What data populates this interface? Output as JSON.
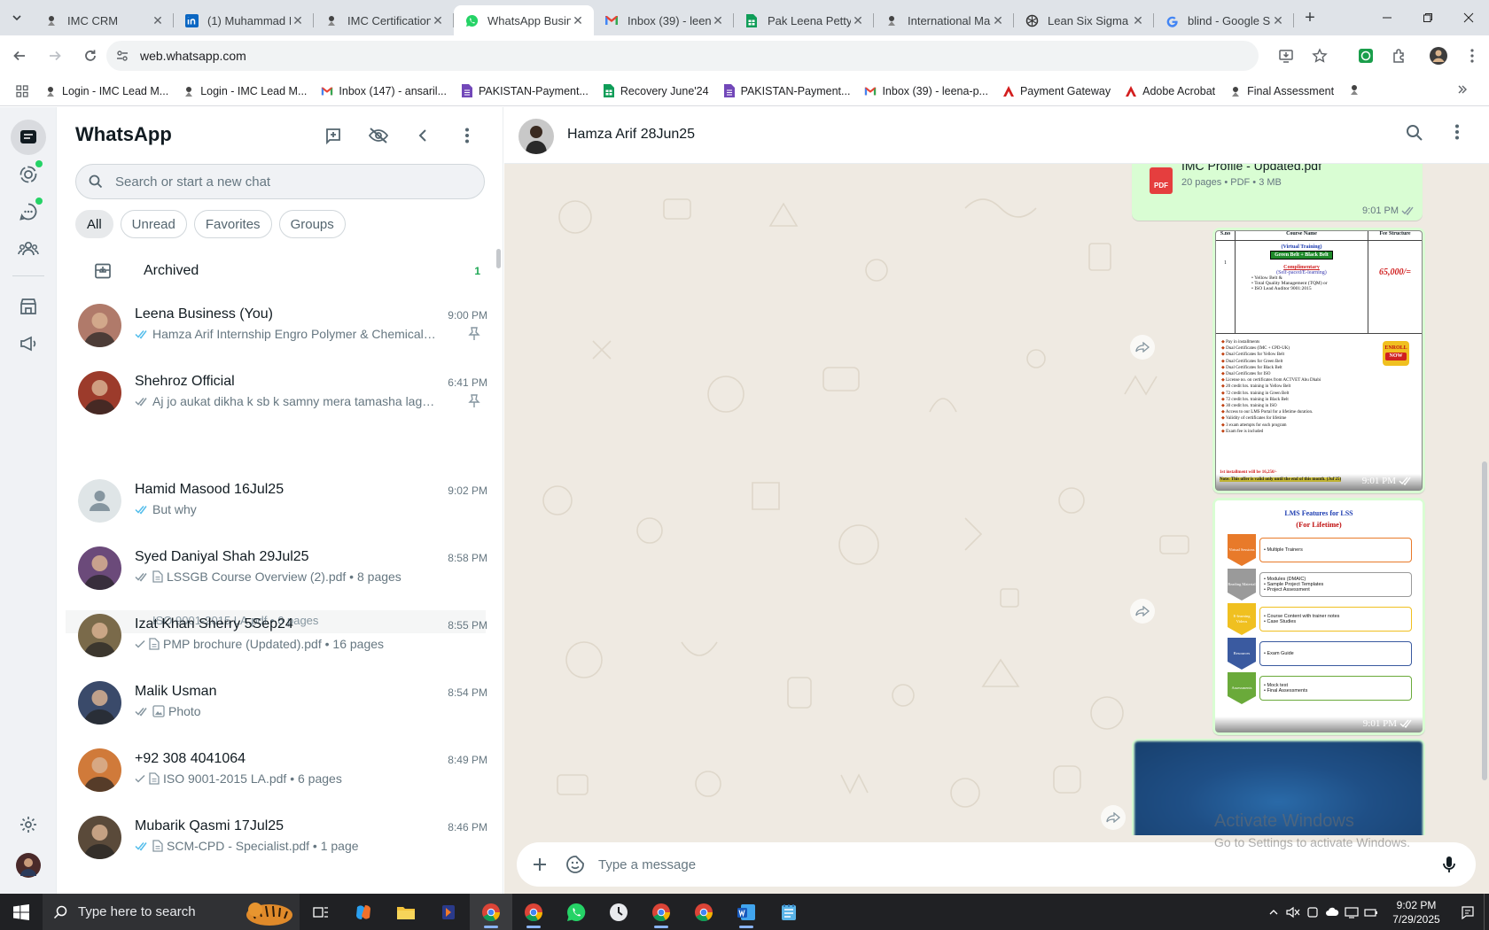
{
  "browser": {
    "tabs": [
      {
        "title": "IMC CRM",
        "favicon": "imc-icon",
        "active": false
      },
      {
        "title": "(1) Muhammad I",
        "favicon": "linkedin-icon",
        "active": false
      },
      {
        "title": "IMC Certification",
        "favicon": "imc-icon",
        "active": false
      },
      {
        "title": "WhatsApp Busin",
        "favicon": "whatsapp-icon",
        "active": true
      },
      {
        "title": "Inbox (39) - leen",
        "favicon": "gmail-icon",
        "active": false
      },
      {
        "title": "Pak Leena Petty",
        "favicon": "sheets-icon",
        "active": false
      },
      {
        "title": "International Ma",
        "favicon": "imc-icon",
        "active": false
      },
      {
        "title": "Lean Six Sigma C",
        "favicon": "chatgpt-icon",
        "active": false
      },
      {
        "title": "blind - Google S",
        "favicon": "google-icon",
        "active": false
      }
    ],
    "url": "web.whatsapp.com",
    "bookmarks": [
      {
        "label": "Login - IMC Lead M...",
        "icon": "imc-icon"
      },
      {
        "label": "Login - IMC Lead M...",
        "icon": "imc-icon"
      },
      {
        "label": "Inbox (147) - ansaril...",
        "icon": "gmail-icon"
      },
      {
        "label": "PAKISTAN-Payment...",
        "icon": "forms-icon"
      },
      {
        "label": "Recovery June'24",
        "icon": "sheets-icon"
      },
      {
        "label": "PAKISTAN-Payment...",
        "icon": "forms-icon"
      },
      {
        "label": "Inbox (39) - leena-p...",
        "icon": "gmail-icon"
      },
      {
        "label": "Payment Gateway",
        "icon": "acrobat-icon"
      },
      {
        "label": "Adobe Acrobat",
        "icon": "acrobat-icon"
      },
      {
        "label": "Final Assessment",
        "icon": "imc-icon"
      }
    ]
  },
  "sidebar": {
    "title": "WhatsApp",
    "search_placeholder": "Search or start a new chat",
    "filters": [
      "All",
      "Unread",
      "Favorites",
      "Groups"
    ],
    "archived_label": "Archived",
    "archived_count": "1",
    "ghost_preview": "ISO 9001-2015 LA.pdf • 6 pages",
    "chats": [
      {
        "name": "Leena Business (You)",
        "time": "9:00 PM",
        "preview": "Hamza Arif Internship Engro Polymer & Chemical Li...",
        "tick": "double-blue",
        "pinned": true,
        "avatar": "#b07a6a"
      },
      {
        "name": "Shehroz Official",
        "time": "6:41 PM",
        "preview": "Aj jo aukat dikha k sb k samny mera tamasha lagay...",
        "tick": "double-grey",
        "pinned": true,
        "avatar": "#9c3b2b"
      },
      {
        "name": "Hamid Masood 16Jul25",
        "time": "9:02 PM",
        "preview": "But why",
        "tick": "double-blue",
        "pinned": false,
        "avatar": "default"
      },
      {
        "name": "Syed Daniyal Shah 29Jul25",
        "time": "8:58 PM",
        "preview": "LSSGB Course Overview (2).pdf • 8 pages",
        "tick": "double-grey",
        "doc": true,
        "pinned": false,
        "avatar": "#6b4a7a"
      },
      {
        "name": "Izat Khan Sherry 5Sep24",
        "time": "8:55 PM",
        "preview": "PMP brochure (Updated).pdf • 16 pages",
        "tick": "single",
        "doc": true,
        "pinned": false,
        "avatar": "#7a6a4a"
      },
      {
        "name": "Malik Usman",
        "time": "8:54 PM",
        "preview": "Photo",
        "tick": "double-grey",
        "photo": true,
        "pinned": false,
        "avatar": "#3a4a6a"
      },
      {
        "name": "+92 308 4041064",
        "time": "8:49 PM",
        "preview": "ISO 9001-2015 LA.pdf • 6 pages",
        "tick": "single",
        "doc": true,
        "pinned": false,
        "avatar": "#d07a3a"
      },
      {
        "name": "Mubarik Qasmi 17Jul25",
        "time": "8:46 PM",
        "preview": "SCM-CPD - Specialist.pdf • 1 page",
        "tick": "double-blue",
        "doc": true,
        "pinned": false,
        "avatar": "#5a4a3a"
      }
    ]
  },
  "conversation": {
    "contact_name": "Hamza Arif 28Jun25",
    "messages": [
      {
        "type": "document",
        "title": "IMC Profile - Updated.pdf",
        "meta": "20 pages • PDF • 3 MB",
        "badge": "PDF",
        "time": "9:01 PM"
      },
      {
        "type": "image",
        "time": "9:01 PM",
        "table_headers": [
          "S.no",
          "Course Name",
          "Fee Structure"
        ],
        "sno": "1",
        "mode": "(Virtual Training)",
        "program": "Green Belt + Black Belt",
        "fee": "65,000/=",
        "complimentary": "Complimentary",
        "complimentary_sub": "(Self-paced/E-learning)",
        "complimentary_items": [
          "Yellow Belt &",
          "Total Quality Management (TQM) or",
          "ISO Lead Auditor 9001:2015"
        ],
        "benefits": [
          "Pay in installments",
          "Dual Certificates (IMC + CPD-UK)",
          "Dual Certificates for Yellow Belt",
          "Dual Certificates for Green Belt",
          "Dual Certificates for Black Belt",
          "Dual Certificates for ISO",
          "License no. on certificates from ACTVET Abu Dhabi",
          "20 credit hrs. training in Yellow Belt",
          "72 credit hrs. training in Green Belt",
          "72 credit hrs. training in Black Belt",
          "30 credit hrs. training in ISO",
          "Access to our LMS Portal for a lifetime duration.",
          "Validity of certificates for lifetime",
          "3 exam attempts for each program",
          "Exam fee is included"
        ],
        "enroll": [
          "ENROLL",
          "NOW"
        ],
        "installment_note": "1st installment will be 16,250/-",
        "note": "Note: This offer is valid only until the end of this month. (Jul'25)"
      },
      {
        "type": "image",
        "time": "9:01 PM",
        "lms_title": "LMS Features for LSS",
        "lms_subtitle": "(For Lifetime)",
        "rows": [
          {
            "tag": "Virtual Sessions",
            "color": "#e87a2a",
            "items": [
              "Multiple Trainers"
            ]
          },
          {
            "tag": "Reading Material",
            "color": "#9a9a9a",
            "items": [
              "Modules (DMAIC)",
              "Sample Project Templates",
              "Project Assessment"
            ]
          },
          {
            "tag": "E-learning Videos",
            "color": "#f0c020",
            "items": [
              "Course Content with trainer notes",
              "Case Studies"
            ]
          },
          {
            "tag": "Resources",
            "color": "#3a5aa0",
            "items": [
              "Exam Guide"
            ]
          },
          {
            "tag": "Assessments",
            "color": "#6aaa3a",
            "items": [
              "Mock test",
              "Final Assessments"
            ]
          }
        ]
      },
      {
        "type": "image-blurred"
      }
    ],
    "composer_placeholder": "Type a message",
    "watermark_line1": "Activate Windows",
    "watermark_line2": "Go to Settings to activate Windows."
  },
  "taskbar": {
    "search_text": "Type here to search",
    "time": "9:02 PM",
    "date": "7/29/2025"
  },
  "colors": {
    "accent_green": "#25d366",
    "bubble_out": "#d9fdd3",
    "tick_blue": "#53bdeb",
    "chat_bg": "#efeae2"
  }
}
